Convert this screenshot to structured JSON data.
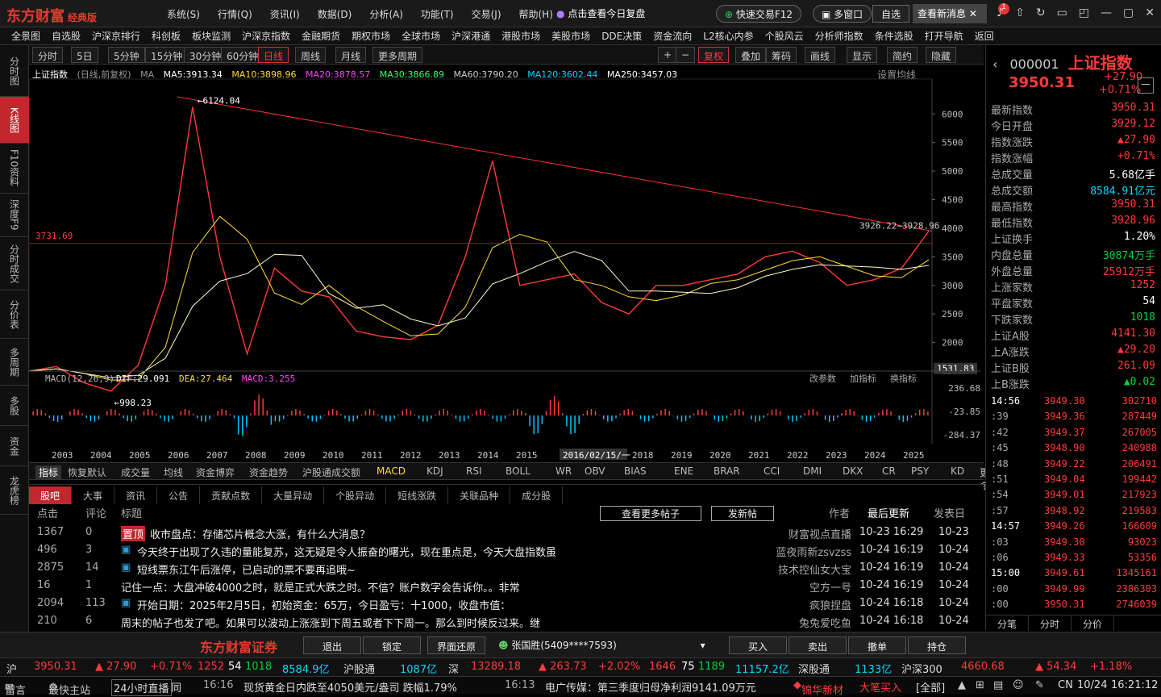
{
  "app": {
    "brand": "东方财富",
    "edition": "经典版",
    "promo": "点击查看今日复盘",
    "quick_trade": "快速交易F12",
    "multi_window": "多窗口",
    "self_select": "自选",
    "new_msg": "查看新消息",
    "badge": "1"
  },
  "topmenu": [
    "系统(S)",
    "行情(Q)",
    "资讯(I)",
    "数据(D)",
    "分析(A)",
    "功能(T)",
    "交易(J)",
    "帮助(H)"
  ],
  "navbar": [
    "全景图",
    "自选股",
    "沪深京排行",
    "科创板",
    "板块监测",
    "沪深京指数",
    "金融期货",
    "期权市场",
    "全球市场",
    "沪深港通",
    "港股市场",
    "美股市场",
    "DDE决策",
    "资金流向",
    "L2核心内参",
    "个股风云",
    "分析师指数",
    "条件选股",
    "打开导航",
    "返回"
  ],
  "leftnav": [
    "分时图",
    "K线图",
    "F10资料",
    "深度F9",
    "分时成交",
    "分价表",
    "多周期",
    "多股",
    "资金",
    "龙虎榜"
  ],
  "periods": [
    "分时",
    "5日",
    "5分钟",
    "15分钟",
    "30分钟",
    "60分钟",
    "日线",
    "周线",
    "月线",
    "更多周期"
  ],
  "toolbar": [
    "复权",
    "叠加",
    "筹码",
    "画线",
    "显示",
    "简约",
    "隐藏"
  ],
  "chart_info": {
    "name": "上证指数",
    "mode": "(日线,前复权)",
    "ma_label": "MA",
    "ma5": "MA5:3913.34",
    "ma10": "MA10:3898.96",
    "ma20": "MA20:3878.57",
    "ma30": "MA30:3866.89",
    "ma60": "MA60:3790.20",
    "ma120": "MA120:3602.44",
    "ma250": "MA250:3457.03",
    "set_ma": "设置均线",
    "peak_label": "6124.04",
    "low_label": "998.23",
    "hline_label": "3731.69",
    "right_labels": "3926.22~3928.96",
    "corner_price": "1531.83",
    "cursor_date": "2016/02/15/一"
  },
  "chart_data": {
    "type": "line",
    "title": "上证指数",
    "x": [
      "2003",
      "2004",
      "2005",
      "2006",
      "2007",
      "2008",
      "2009",
      "2010",
      "2011",
      "2012",
      "2013",
      "2014",
      "2015",
      "2016",
      "2017",
      "2018",
      "2019",
      "2020",
      "2021",
      "2022",
      "2023",
      "2024",
      "2025"
    ],
    "y_ticks": [
      6000,
      5500,
      5000,
      4500,
      4000,
      3500,
      3000,
      2500,
      2000,
      1500
    ],
    "ylim": [
      1500,
      6300
    ],
    "sample_close": [
      1500,
      1580,
      1300,
      1150,
      1600,
      3000,
      6124,
      3500,
      1800,
      3300,
      2900,
      2800,
      2200,
      2100,
      2050,
      2300,
      3500,
      5178,
      3000,
      3100,
      3200,
      2700,
      2500,
      3000,
      3000,
      3100,
      3200,
      3500,
      3600,
      3400,
      3000,
      3100,
      3300,
      3950
    ]
  },
  "macd": {
    "label": "MACD(12,26,9)",
    "dif": "DIF:29.091",
    "dea": "DEA:27.464",
    "macd": "MACD:3.255",
    "ticks": [
      "236.68",
      "-23.85",
      "-284.37"
    ],
    "actions": [
      "改参数",
      "加指标",
      "换指标"
    ]
  },
  "years": [
    "2003",
    "2004",
    "2005",
    "2006",
    "2007",
    "2008",
    "2009",
    "2010",
    "2011",
    "2012",
    "2013",
    "2014",
    "2015",
    "",
    "2018",
    "2019",
    "2020",
    "2021",
    "2022",
    "2023",
    "2024",
    "2025"
  ],
  "indicators": [
    "指标",
    "恢复默认",
    "成交量",
    "均线",
    "资金博弈",
    "资金趋势",
    "沪股通成交额",
    "MACD",
    "KDJ",
    "RSI",
    "BOLL",
    "WR",
    "OBV",
    "BIAS",
    "ENE",
    "BRAR",
    "CCI",
    "DMI",
    "DKX",
    "CR",
    "PSY",
    "KD",
    "更多",
    "模板"
  ],
  "bottom_tabs": [
    "股吧",
    "大事",
    "资讯",
    "公告",
    "贡献点数",
    "大量异动",
    "个股异动",
    "短线涨跌",
    "关联品种",
    "成分股"
  ],
  "bottom_hdr": {
    "click": "点击",
    "comment": "评论",
    "title": "标题",
    "more": "查看更多帖子",
    "post": "发新帖",
    "author": "作者",
    "updated": "最后更新",
    "posted": "发表日"
  },
  "posts": [
    {
      "click": "1367",
      "comment": "0",
      "tag": "置顶",
      "title": "收市盘点：存储芯片概念大涨，有什么大消息？",
      "author": "财富视点直播",
      "updated": "10-23 16:29",
      "posted": "10-23"
    },
    {
      "click": "496",
      "comment": "3",
      "tag": "",
      "title": "今天终于出现了久违的量能复苏，这无疑是令人振奋的曙光，现在重点是，今天大盘指数虽",
      "author": "蓝夜雨新zsvzss",
      "updated": "10-24 16:19",
      "posted": "10-24"
    },
    {
      "click": "2875",
      "comment": "14",
      "tag": "",
      "title": "短线票东江午后涨停，已启动的票不要再追哦~",
      "author": "技术控仙女大宝",
      "updated": "10-24 16:19",
      "posted": "10-24"
    },
    {
      "click": "16",
      "comment": "1",
      "tag": "",
      "title": "记住一点：大盘冲破4000之时，就是正式大跌之时。不信？账户数字会告诉你。。非常",
      "author": "空方一号",
      "updated": "10-24 16:19",
      "posted": "10-24"
    },
    {
      "click": "2094",
      "comment": "113",
      "tag": "",
      "title": "开始日期：2025年2月5日，初始资金：65万，今日盈亏：十1000，收盘市值：",
      "author": "疯狼捏盘",
      "updated": "10-24 16:18",
      "posted": "10-24"
    },
    {
      "click": "210",
      "comment": "6",
      "tag": "",
      "title": "周末的帖子也发了吧。如果可以波动上涨涨到下周五或者下下周一。那么到时候反过来。继",
      "author": "兔兔爱吃鱼",
      "updated": "10-24 16:18",
      "posted": "10-24"
    }
  ],
  "quote": {
    "code": "000001",
    "name": "上证指数",
    "price": "3950.31",
    "change": "+27.90",
    "pct": "+0.71%"
  },
  "stats": [
    {
      "k": "最新指数",
      "v": "3950.31",
      "c": "red"
    },
    {
      "k": "今日开盘",
      "v": "3929.12",
      "c": "red"
    },
    {
      "k": "指数涨跌",
      "v": "▲27.90",
      "c": "red"
    },
    {
      "k": "指数涨幅",
      "v": "+0.71%",
      "c": "red"
    },
    {
      "k": "总成交量",
      "v": "5.68亿手",
      "c": "white"
    },
    {
      "k": "总成交额",
      "v": "8584.91亿元",
      "c": "cyan"
    },
    {
      "k": "最高指数",
      "v": "3950.31",
      "c": "red"
    },
    {
      "k": "最低指数",
      "v": "3928.96",
      "c": "red"
    },
    {
      "k": "上证换手",
      "v": "1.20%",
      "c": "white"
    },
    {
      "k": "内盘总量",
      "v": "30874万手",
      "c": "green"
    },
    {
      "k": "外盘总量",
      "v": "25912万手",
      "c": "red"
    },
    {
      "k": "上涨家数",
      "v": "1252",
      "c": "red"
    },
    {
      "k": "平盘家数",
      "v": "54",
      "c": "white"
    },
    {
      "k": "下跌家数",
      "v": "1018",
      "c": "green"
    },
    {
      "k": "上证A股",
      "v": "4141.30",
      "c": "red"
    },
    {
      "k": "上A涨跌",
      "v": "▲29.20",
      "c": "red"
    },
    {
      "k": "上证B股",
      "v": "261.09",
      "c": "red"
    },
    {
      "k": "上B涨跌",
      "v": "▲0.02",
      "c": "green"
    }
  ],
  "ticks": [
    {
      "t": "14:56",
      "p": "3949.30",
      "v": "302710"
    },
    {
      "t": ":39",
      "p": "3949.36",
      "v": "287449"
    },
    {
      "t": ":42",
      "p": "3949.37",
      "v": "267005"
    },
    {
      "t": ":45",
      "p": "3948.90",
      "v": "240988"
    },
    {
      "t": ":48",
      "p": "3949.22",
      "v": "206491"
    },
    {
      "t": ":51",
      "p": "3949.04",
      "v": "199442"
    },
    {
      "t": ":54",
      "p": "3949.01",
      "v": "217923"
    },
    {
      "t": ":57",
      "p": "3948.92",
      "v": "219583"
    },
    {
      "t": "14:57",
      "p": "3949.26",
      "v": "166609"
    },
    {
      "t": ":03",
      "p": "3949.30",
      "v": "93023"
    },
    {
      "t": ":06",
      "p": "3949.33",
      "v": "53356"
    },
    {
      "t": "15:00",
      "p": "3949.61",
      "v": "1345161"
    },
    {
      "t": ":00",
      "p": "3949.99",
      "v": "2386303"
    },
    {
      "t": ":00",
      "p": "3950.31",
      "v": "2746039"
    }
  ],
  "rtabs": [
    "分笔",
    "分时",
    "分价"
  ],
  "trade": {
    "brand": "东方财富证券",
    "buttons": [
      "退出",
      "锁定",
      "界面还原"
    ],
    "user": "张国胜(5409****7593)",
    "actions": [
      "买入",
      "卖出",
      "撤单",
      "持仓"
    ]
  },
  "status": {
    "sh": "沪",
    "sh_price": "3950.31",
    "sh_chg": "▲ 27.90",
    "sh_pct": "+0.71%",
    "up": "1252",
    "flat": "54",
    "down": "1018",
    "amt": "8584.9亿",
    "hgt": "沪股通",
    "hgt_v": "1087亿",
    "sz": "深",
    "sz_price": "13289.18",
    "sz_chg": "▲ 263.73",
    "sz_pct": "+2.02%",
    "sz_up": "1646",
    "sz_flat": "75",
    "sz_down": "1189",
    "sz_amt": "11157.2亿",
    "sgt": "深股通",
    "sgt_v": "1133亿",
    "hs300": "沪深300",
    "hs_price": "4660.68",
    "hs_chg": "▲ 54.34",
    "hs_pct": "+1.18%",
    "time": "16:21:12"
  },
  "news": {
    "a": "留言",
    "b": "最快主站",
    "c": "24小时直播",
    "d": "同",
    "t1": "16:16",
    "n1": "现货黄金日内跌至4050美元/盎司 跌幅1.79%",
    "t2": "16:13",
    "n2": "电广传媒：第三季度归母净利润9141.09万元",
    "stock": "锦华新材",
    "act": "大笔买入",
    "all": "[全部]",
    "cn": "CN",
    "date": "10/24",
    "clock": "16:21:12"
  }
}
